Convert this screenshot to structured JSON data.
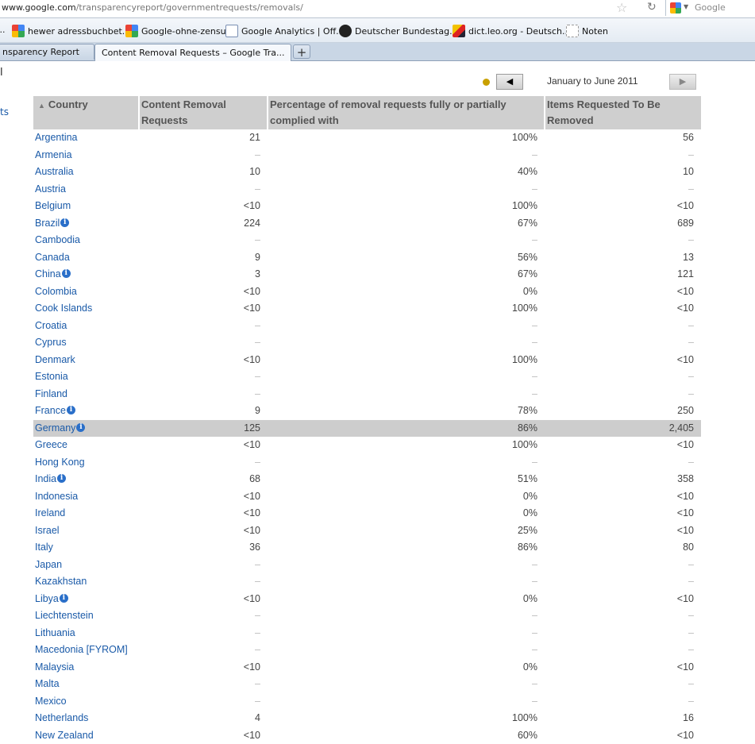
{
  "browser": {
    "url_host": "www.google.com",
    "url_path": "/transparencyreport/governmentrequests/removals/",
    "search_placeholder": "Google",
    "bookmarks": [
      {
        "label": "...",
        "icon": "google-icon"
      },
      {
        "label": "hewer adressbuchbet...",
        "icon": "google-icon"
      },
      {
        "label": "Google-ohne-zensur",
        "icon": "google-icon"
      },
      {
        "label": "Google Analytics | Off...",
        "icon": "analytics-icon"
      },
      {
        "label": "Deutscher Bundestag...",
        "icon": "eagle-icon"
      },
      {
        "label": "dict.leo.org - Deutsch...",
        "icon": "leo-icon"
      },
      {
        "label": "Noten",
        "icon": "page-icon"
      }
    ],
    "tabs": [
      {
        "label": "nsparency Report",
        "active": false
      },
      {
        "label": "Content Removal Requests – Google Tra...",
        "active": true,
        "close": "✕"
      }
    ],
    "new_tab": "+"
  },
  "page": {
    "cut_left_text": "l",
    "cut_left_link": "ts",
    "period": {
      "label": "January to June 2011",
      "prev": "◀",
      "next": "▶",
      "indicator_color": "#c9a000"
    },
    "table": {
      "headers": {
        "country": "Country",
        "requests": "Content Removal Requests",
        "percentage": "Percentage of removal requests fully or partially complied with",
        "items": "Items Requested To Be Removed"
      },
      "sort_indicator": "▲",
      "rows": [
        {
          "country": "Argentina",
          "requests": "21",
          "pct": "100%",
          "items": "56"
        },
        {
          "country": "Armenia",
          "requests": "–",
          "pct": "–",
          "items": "–"
        },
        {
          "country": "Australia",
          "requests": "10",
          "pct": "40%",
          "items": "10"
        },
        {
          "country": "Austria",
          "requests": "–",
          "pct": "–",
          "items": "–"
        },
        {
          "country": "Belgium",
          "requests": "<10",
          "pct": "100%",
          "items": "<10"
        },
        {
          "country": "Brazil",
          "info": true,
          "requests": "224",
          "pct": "67%",
          "items": "689"
        },
        {
          "country": "Cambodia",
          "requests": "–",
          "pct": "–",
          "items": "–"
        },
        {
          "country": "Canada",
          "requests": "9",
          "pct": "56%",
          "items": "13"
        },
        {
          "country": "China",
          "info": true,
          "requests": "3",
          "pct": "67%",
          "items": "121"
        },
        {
          "country": "Colombia",
          "requests": "<10",
          "pct": "0%",
          "items": "<10"
        },
        {
          "country": "Cook Islands",
          "requests": "<10",
          "pct": "100%",
          "items": "<10"
        },
        {
          "country": "Croatia",
          "requests": "–",
          "pct": "–",
          "items": "–"
        },
        {
          "country": "Cyprus",
          "requests": "–",
          "pct": "–",
          "items": "–"
        },
        {
          "country": "Denmark",
          "requests": "<10",
          "pct": "100%",
          "items": "<10"
        },
        {
          "country": "Estonia",
          "requests": "–",
          "pct": "–",
          "items": "–"
        },
        {
          "country": "Finland",
          "requests": "–",
          "pct": "–",
          "items": "–"
        },
        {
          "country": "France",
          "info": true,
          "requests": "9",
          "pct": "78%",
          "items": "250"
        },
        {
          "country": "Germany",
          "info": true,
          "highlight": true,
          "requests": "125",
          "pct": "86%",
          "items": "2,405"
        },
        {
          "country": "Greece",
          "requests": "<10",
          "pct": "100%",
          "items": "<10"
        },
        {
          "country": "Hong Kong",
          "requests": "–",
          "pct": "–",
          "items": "–"
        },
        {
          "country": "India",
          "info": true,
          "requests": "68",
          "pct": "51%",
          "items": "358"
        },
        {
          "country": "Indonesia",
          "requests": "<10",
          "pct": "0%",
          "items": "<10"
        },
        {
          "country": "Ireland",
          "requests": "<10",
          "pct": "0%",
          "items": "<10"
        },
        {
          "country": "Israel",
          "requests": "<10",
          "pct": "25%",
          "items": "<10"
        },
        {
          "country": "Italy",
          "requests": "36",
          "pct": "86%",
          "items": "80"
        },
        {
          "country": "Japan",
          "requests": "–",
          "pct": "–",
          "items": "–"
        },
        {
          "country": "Kazakhstan",
          "requests": "–",
          "pct": "–",
          "items": "–"
        },
        {
          "country": "Libya",
          "info": true,
          "requests": "<10",
          "pct": "0%",
          "items": "<10"
        },
        {
          "country": "Liechtenstein",
          "requests": "–",
          "pct": "–",
          "items": "–"
        },
        {
          "country": "Lithuania",
          "requests": "–",
          "pct": "–",
          "items": "–"
        },
        {
          "country": "Macedonia [FYROM]",
          "requests": "–",
          "pct": "–",
          "items": "–"
        },
        {
          "country": "Malaysia",
          "requests": "<10",
          "pct": "0%",
          "items": "<10"
        },
        {
          "country": "Malta",
          "requests": "–",
          "pct": "–",
          "items": "–"
        },
        {
          "country": "Mexico",
          "requests": "–",
          "pct": "–",
          "items": "–"
        },
        {
          "country": "Netherlands",
          "requests": "4",
          "pct": "100%",
          "items": "16"
        },
        {
          "country": "New Zealand",
          "requests": "<10",
          "pct": "60%",
          "items": "<10"
        }
      ]
    }
  }
}
